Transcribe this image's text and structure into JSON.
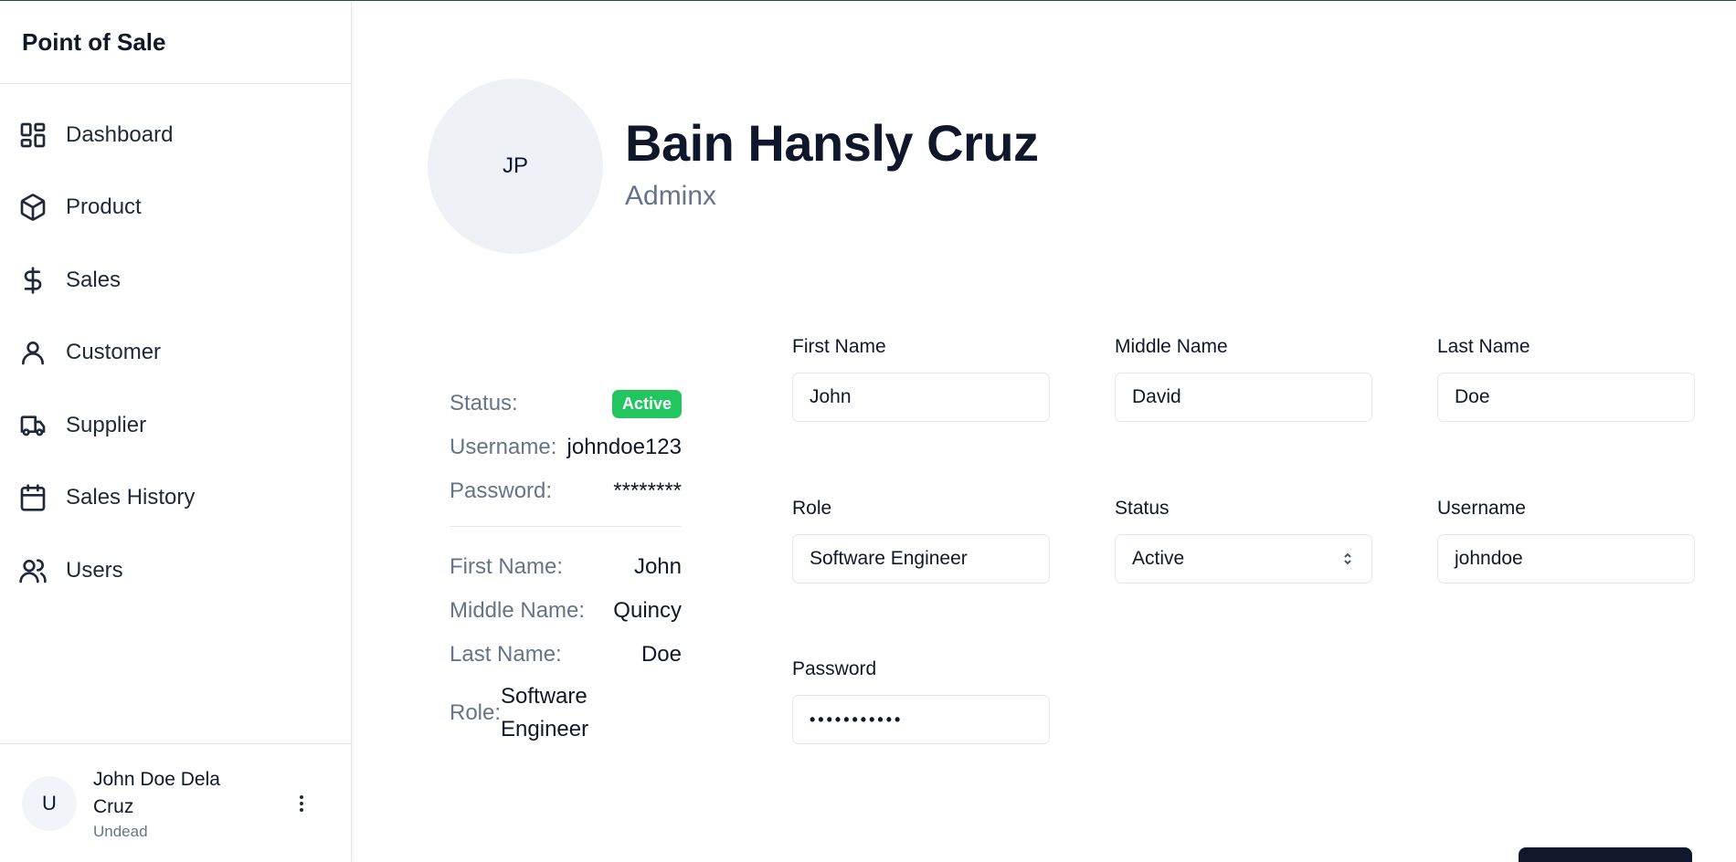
{
  "app": {
    "title": "Point of Sale"
  },
  "sidebar": {
    "items": [
      {
        "label": "Dashboard",
        "icon": "dashboard-icon"
      },
      {
        "label": "Product",
        "icon": "box-icon"
      },
      {
        "label": "Sales",
        "icon": "dollar-icon"
      },
      {
        "label": "Customer",
        "icon": "user-icon"
      },
      {
        "label": "Supplier",
        "icon": "truck-icon"
      },
      {
        "label": "Sales History",
        "icon": "calendar-icon"
      },
      {
        "label": "Users",
        "icon": "users-icon"
      }
    ],
    "user": {
      "initial": "U",
      "name": "John Doe Dela Cruz",
      "role": "Undead"
    }
  },
  "profile": {
    "initials": "JP",
    "name": "Bain Hansly Cruz",
    "role": "Adminx"
  },
  "summary": {
    "status_label": "Status:",
    "status_value": "Active",
    "username_label": "Username:",
    "username_value": "johndoe123",
    "password_label": "Password:",
    "password_value": "********",
    "first_name_label": "First Name:",
    "first_name_value": "John",
    "middle_name_label": "Middle Name:",
    "middle_name_value": "Quincy",
    "last_name_label": "Last Name:",
    "last_name_value": "Doe",
    "role_label": "Role:",
    "role_value": "Software Engineer"
  },
  "form": {
    "first_name": {
      "label": "First Name",
      "value": "John"
    },
    "middle_name": {
      "label": "Middle Name",
      "value": "David"
    },
    "last_name": {
      "label": "Last Name",
      "value": "Doe"
    },
    "role": {
      "label": "Role",
      "value": "Software Engineer"
    },
    "status": {
      "label": "Status",
      "value": "Active"
    },
    "username": {
      "label": "Username",
      "value": "johndoe"
    },
    "password": {
      "label": "Password",
      "value": "•••••••••••"
    }
  },
  "colors": {
    "accent": "#0f172a",
    "active_badge": "#22c55e",
    "muted": "#64748b"
  }
}
